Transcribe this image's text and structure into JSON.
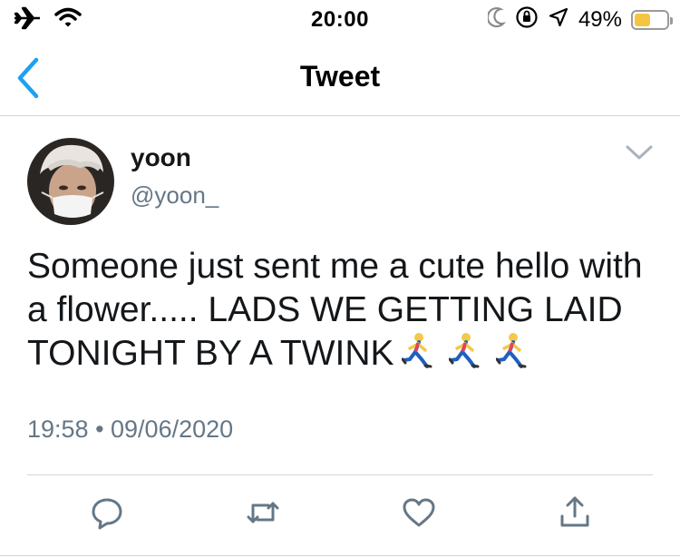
{
  "status_bar": {
    "time": "20:00",
    "battery_percent": "49%",
    "battery_level": 0.49,
    "icons": [
      "airplane-icon",
      "wifi-icon",
      "moon-icon",
      "orientation-lock-icon",
      "location-icon",
      "battery-icon"
    ]
  },
  "nav": {
    "title": "Tweet",
    "back_icon": "chevron-left-icon",
    "accent_color": "#1da1f2"
  },
  "tweet": {
    "display_name": "yoon",
    "handle": "@yoon_",
    "text": "Someone just sent me a cute hello with a flower..... LADS WE GETTING LAID TONIGHT BY A TWINK",
    "emoji": [
      "woman-running-emoji",
      "woman-running-emoji",
      "woman-running-emoji"
    ],
    "timestamp": "19:58 • 09/06/2020"
  },
  "actions": [
    {
      "name": "reply-button",
      "icon": "reply-icon"
    },
    {
      "name": "retweet-button",
      "icon": "retweet-icon"
    },
    {
      "name": "like-button",
      "icon": "heart-icon"
    },
    {
      "name": "share-button",
      "icon": "share-icon"
    }
  ],
  "colors": {
    "icon_gray": "#657786",
    "divider": "#cfd6dc"
  }
}
